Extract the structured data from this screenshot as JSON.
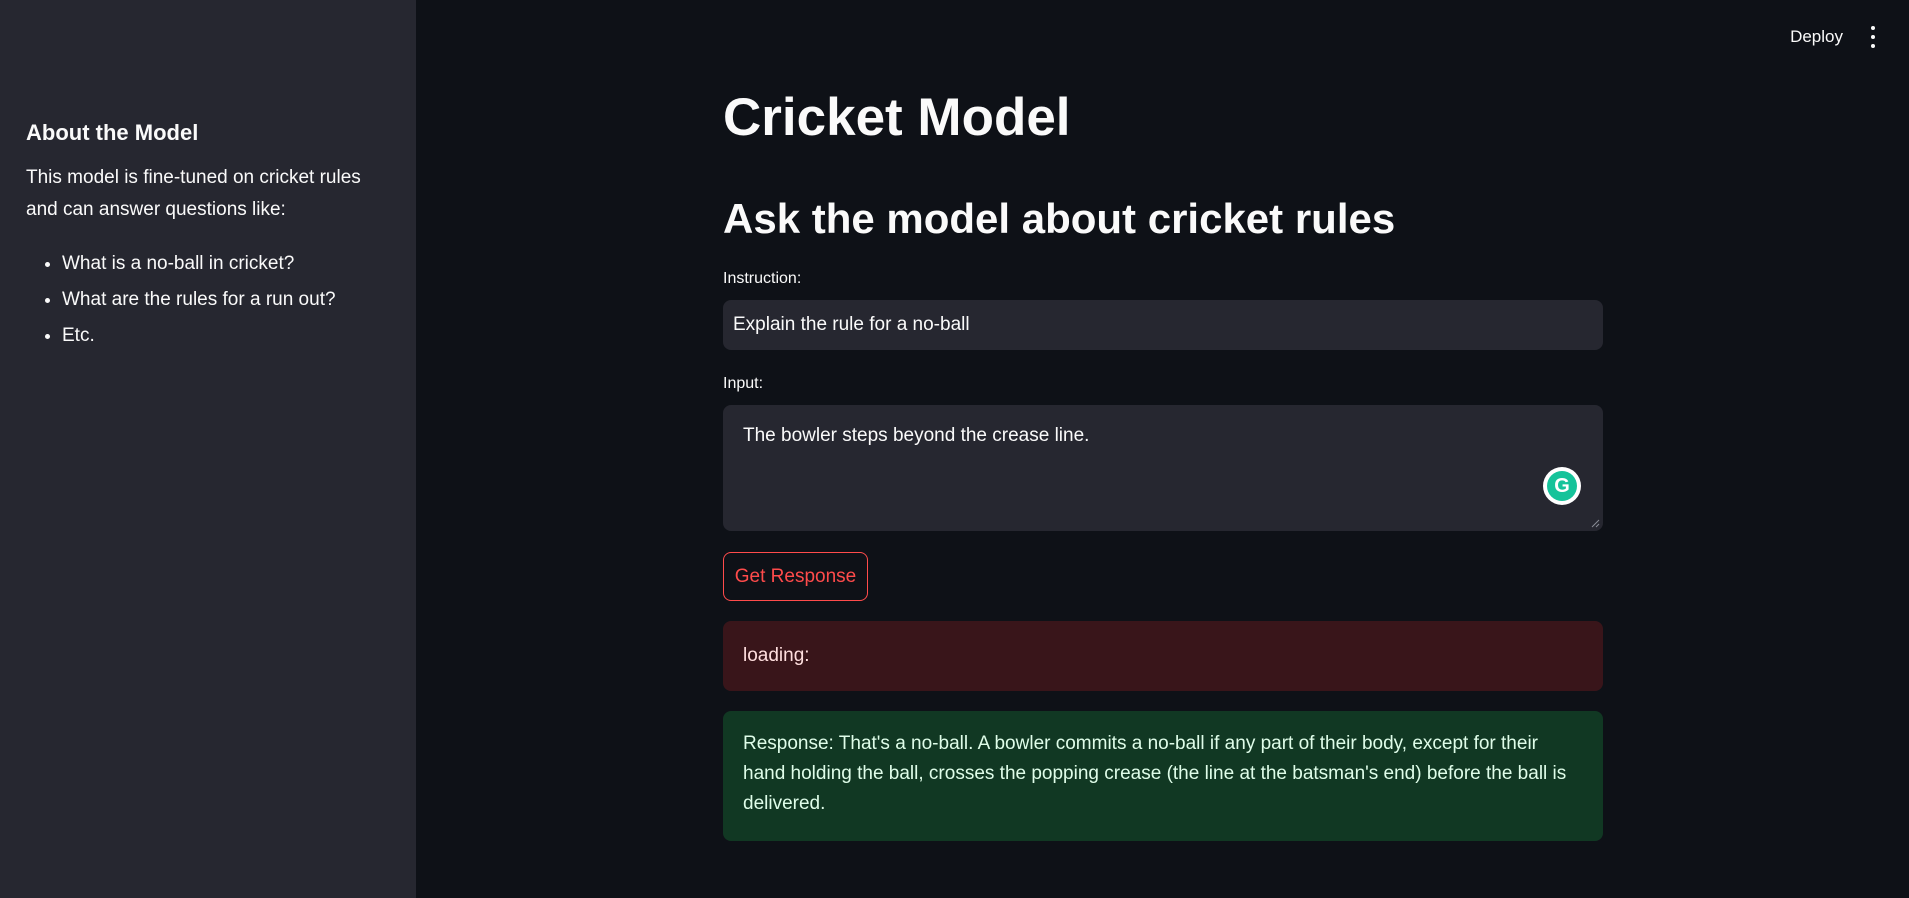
{
  "header": {
    "deploy_label": "Deploy",
    "menu_icon": "kebab-menu-icon"
  },
  "sidebar": {
    "heading": "About the Model",
    "description": "This model is fine-tuned on cricket rules and can answer questions like:",
    "items": [
      {
        "label": "What is a no-ball in cricket?"
      },
      {
        "label": "What are the rules for a run out?"
      },
      {
        "label": "Etc."
      }
    ]
  },
  "main": {
    "title": "Cricket Model",
    "subtitle": "Ask the model about cricket rules",
    "instruction": {
      "label": "Instruction:",
      "value": "Explain the rule for a no-ball"
    },
    "input": {
      "label": "Input:",
      "value": "The bowler steps beyond the crease line."
    },
    "button_label": "Get Response",
    "status_text": "loading:",
    "response_text": "Response: That's a no-ball. A bowler commits a no-ball if any part of their body, except for their hand holding the ball, crosses the popping crease (the line at the batsman's end) before the ball is delivered."
  },
  "colors": {
    "background": "#0e1117",
    "sidebar": "#262730",
    "accent": "#ff4b4b",
    "grammarly": "#15c39a"
  }
}
